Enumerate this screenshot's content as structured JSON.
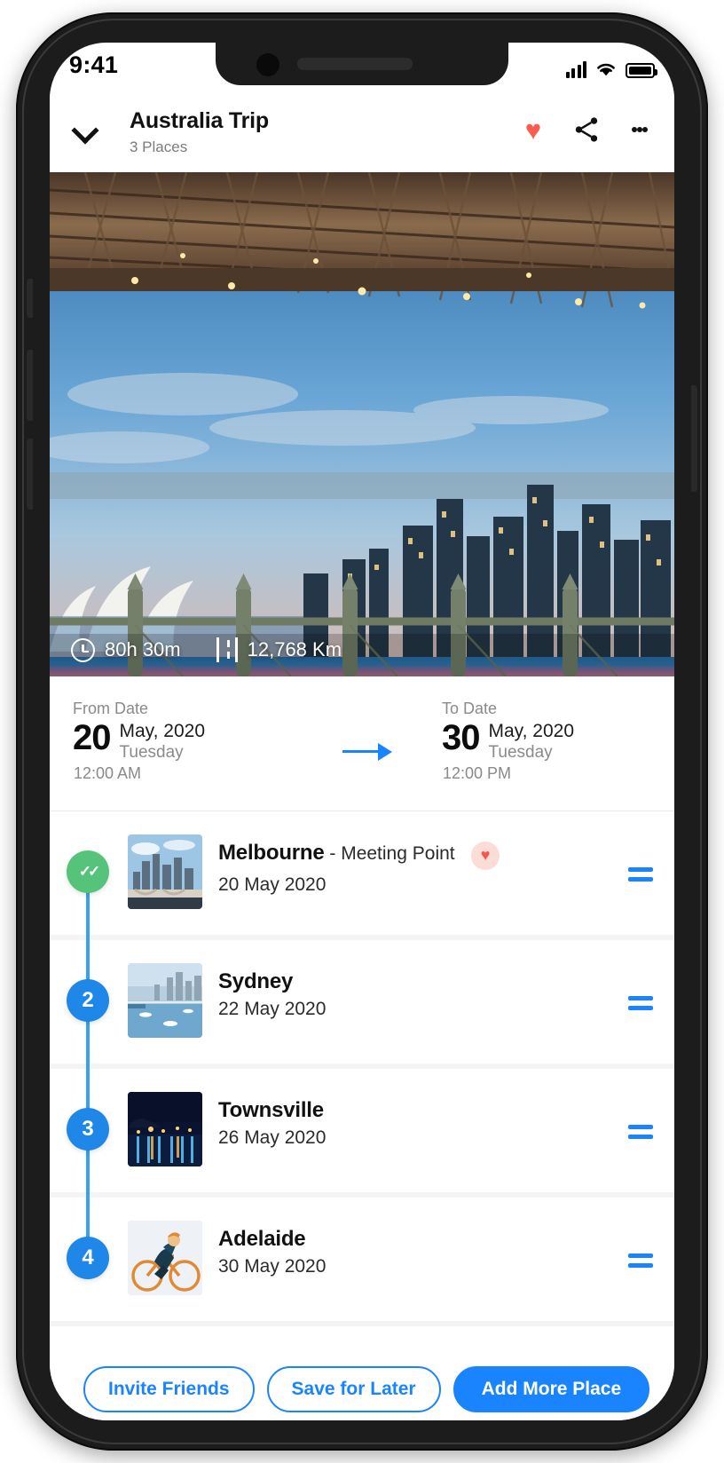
{
  "status_bar": {
    "time": "9:41",
    "signal_icon": "signal-bars-icon",
    "wifi_icon": "wifi-icon",
    "battery_icon": "battery-icon"
  },
  "header": {
    "back_icon": "chevron-down-icon",
    "title": "Australia Trip",
    "subtitle": "3 Places",
    "favorite_icon": "heart-icon",
    "share_icon": "share-icon",
    "menu_icon": "more-vertical-icon",
    "accent_color": "#fc5c4c"
  },
  "hero": {
    "alt": "Sydney Harbour Bridge and skyline at dusk",
    "duration_icon": "clock-icon",
    "duration": "80h 30m",
    "distance_icon": "road-icon",
    "distance": "12,768 Km"
  },
  "dates": {
    "from": {
      "label": "From Date",
      "day": "20",
      "month_year": "May, 2020",
      "weekday": "Tuesday",
      "time": "12:00 AM"
    },
    "to": {
      "label": "To Date",
      "day": "30",
      "month_year": "May, 2020",
      "weekday": "Tuesday",
      "time": "12:00 PM"
    },
    "arrow_icon": "arrow-right-icon",
    "accent_color": "#1a84ff"
  },
  "places": [
    {
      "marker": "✓",
      "state": "done",
      "name": "Melbourne",
      "tag": " - Meeting Point",
      "date": "20 May 2020",
      "favorite": true,
      "favorite_icon": "heart-icon",
      "drag_icon": "drag-handle-icon",
      "thumb": "melbourne-skyline"
    },
    {
      "marker": "2",
      "state": "pending",
      "name": "Sydney",
      "tag": "",
      "date": "22 May 2020",
      "favorite": false,
      "drag_icon": "drag-handle-icon",
      "thumb": "sydney-harbour"
    },
    {
      "marker": "3",
      "state": "pending",
      "name": "Townsville",
      "tag": "",
      "date": "26 May 2020",
      "favorite": false,
      "drag_icon": "drag-handle-icon",
      "thumb": "townsville-night"
    },
    {
      "marker": "4",
      "state": "pending",
      "name": "Adelaide",
      "tag": "",
      "date": "30 May 2020",
      "favorite": false,
      "drag_icon": "drag-handle-icon",
      "thumb": "adelaide-cyclist"
    }
  ],
  "actions": {
    "invite_label": "Invite Friends",
    "save_label": "Save for Later",
    "add_label": "Add More Place"
  },
  "colors": {
    "primary": "#1a84ff",
    "success": "#55c37a",
    "danger": "#fc5c4c"
  }
}
